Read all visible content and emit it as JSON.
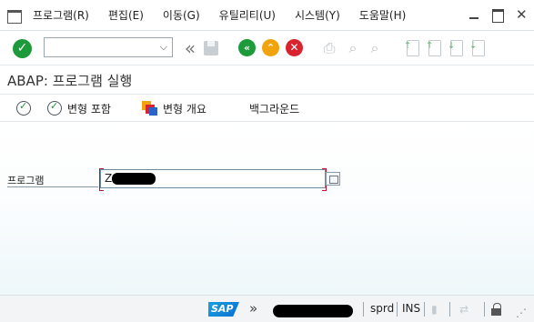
{
  "menu": {
    "items": [
      {
        "label": "프로그램(R)"
      },
      {
        "label": "편집(E)"
      },
      {
        "label": "이동(G)"
      },
      {
        "label": "유틸리티(U)"
      },
      {
        "label": "시스템(Y)"
      },
      {
        "label": "도움말(H)"
      }
    ]
  },
  "toolbar": {
    "command_value": "",
    "dropdown_glyph": "⌵",
    "back_glyph": "«",
    "back_circle_glyph": "«",
    "up_glyph": "⌃",
    "cancel_glyph": "✕"
  },
  "title": {
    "text": "ABAP: 프로그램 실행"
  },
  "app_toolbar": {
    "execute_label": "",
    "variant_include_label": "변형 포함",
    "variant_overview_label": "변형 개요",
    "background_label": "백그라운드"
  },
  "form": {
    "program_label": "프로그램",
    "program_value": "Z"
  },
  "status": {
    "client": "sprd",
    "mode": "INS"
  },
  "colors": {
    "accent_green": "#1d9a3a",
    "accent_orange": "#f0a30a",
    "accent_red": "#d9232e",
    "required_marker": "#c8102e"
  }
}
